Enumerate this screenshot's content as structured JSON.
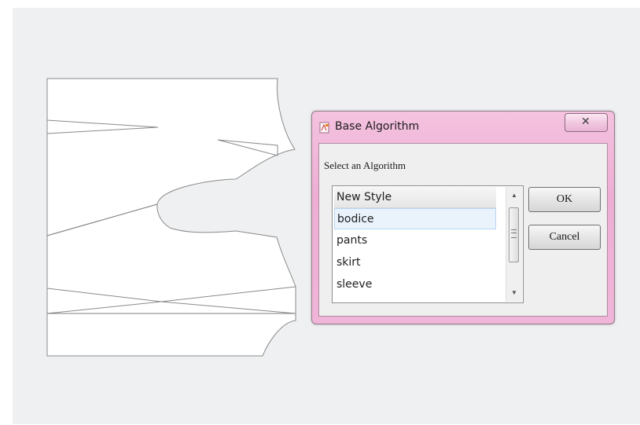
{
  "dialog": {
    "title": "Base Algorithm",
    "app_icon": "app-icon",
    "close_icon": "close-icon",
    "close_glyph": "✕",
    "prompt": "Select an Algorithm",
    "list": {
      "items": [
        "New Style",
        "bodice",
        "pants",
        "skirt",
        "sleeve"
      ],
      "header_item": "New Style",
      "selected": "bodice",
      "scroll_up_glyph": "▲",
      "scroll_down_glyph": "▼"
    },
    "buttons": {
      "ok_label": "OK",
      "cancel_label": "Cancel"
    }
  },
  "colors": {
    "dialog_frame": "#eeaed4",
    "selection": "#eaf3fc",
    "background": "#eff0f1"
  }
}
